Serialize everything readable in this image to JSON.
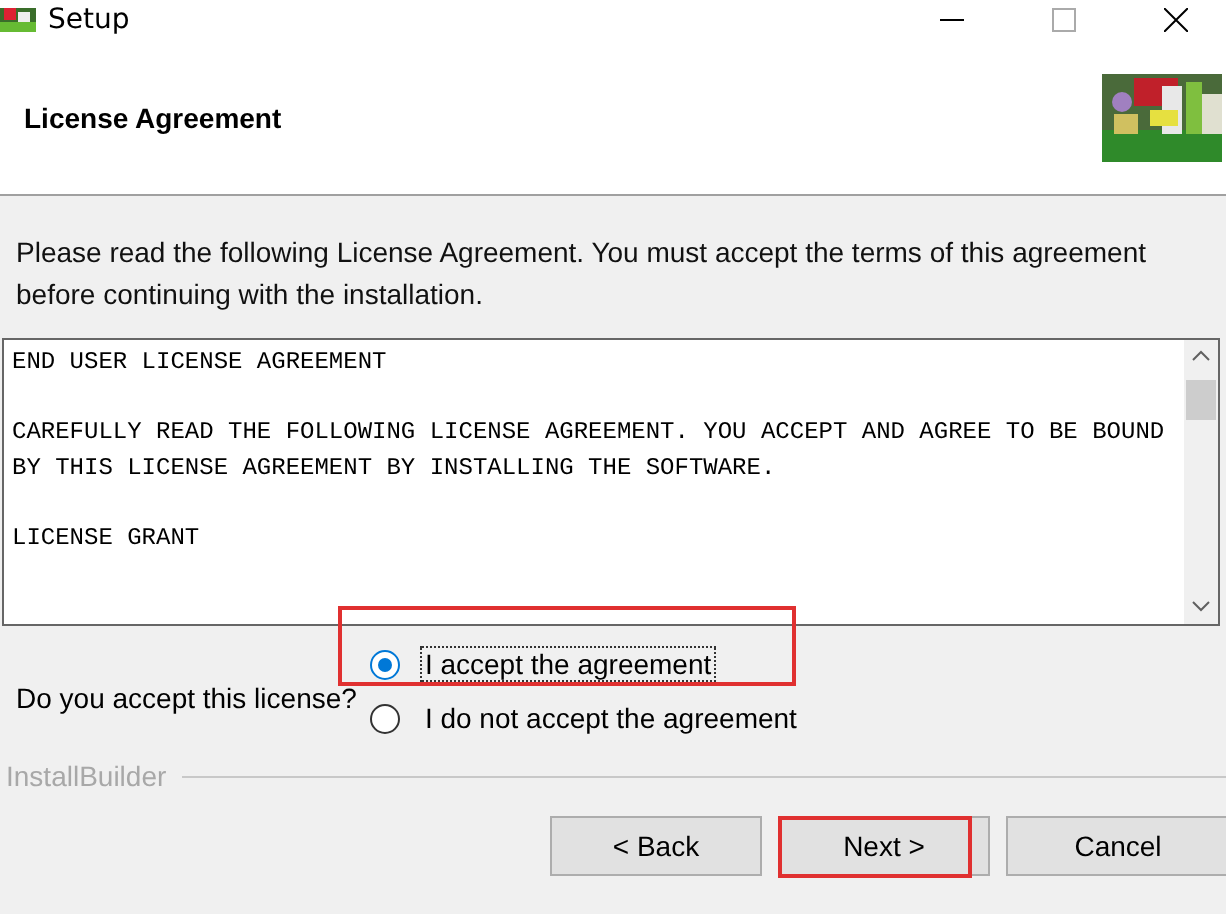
{
  "window": {
    "title": "Setup"
  },
  "header": {
    "title": "License Agreement"
  },
  "intro": "Please read the following License Agreement. You must accept the terms of this agreement before continuing with the installation.",
  "license_text": [
    "END USER LICENSE AGREEMENT",
    "CAREFULLY READ THE FOLLOWING LICENSE AGREEMENT. YOU ACCEPT AND AGREE TO BE BOUND BY THIS LICENSE AGREEMENT BY INSTALLING THE SOFTWARE.",
    "LICENSE GRANT"
  ],
  "question": "Do you accept this license?",
  "options": [
    {
      "label": "I accept the agreement",
      "selected": true,
      "highlighted": true
    },
    {
      "label": "I do not accept the agreement",
      "selected": false,
      "highlighted": false
    }
  ],
  "brand": "InstallBuilder",
  "buttons": [
    {
      "label": "< Back",
      "highlighted": false
    },
    {
      "label": "Next >",
      "highlighted": true
    },
    {
      "label": "Cancel",
      "highlighted": false
    }
  ]
}
